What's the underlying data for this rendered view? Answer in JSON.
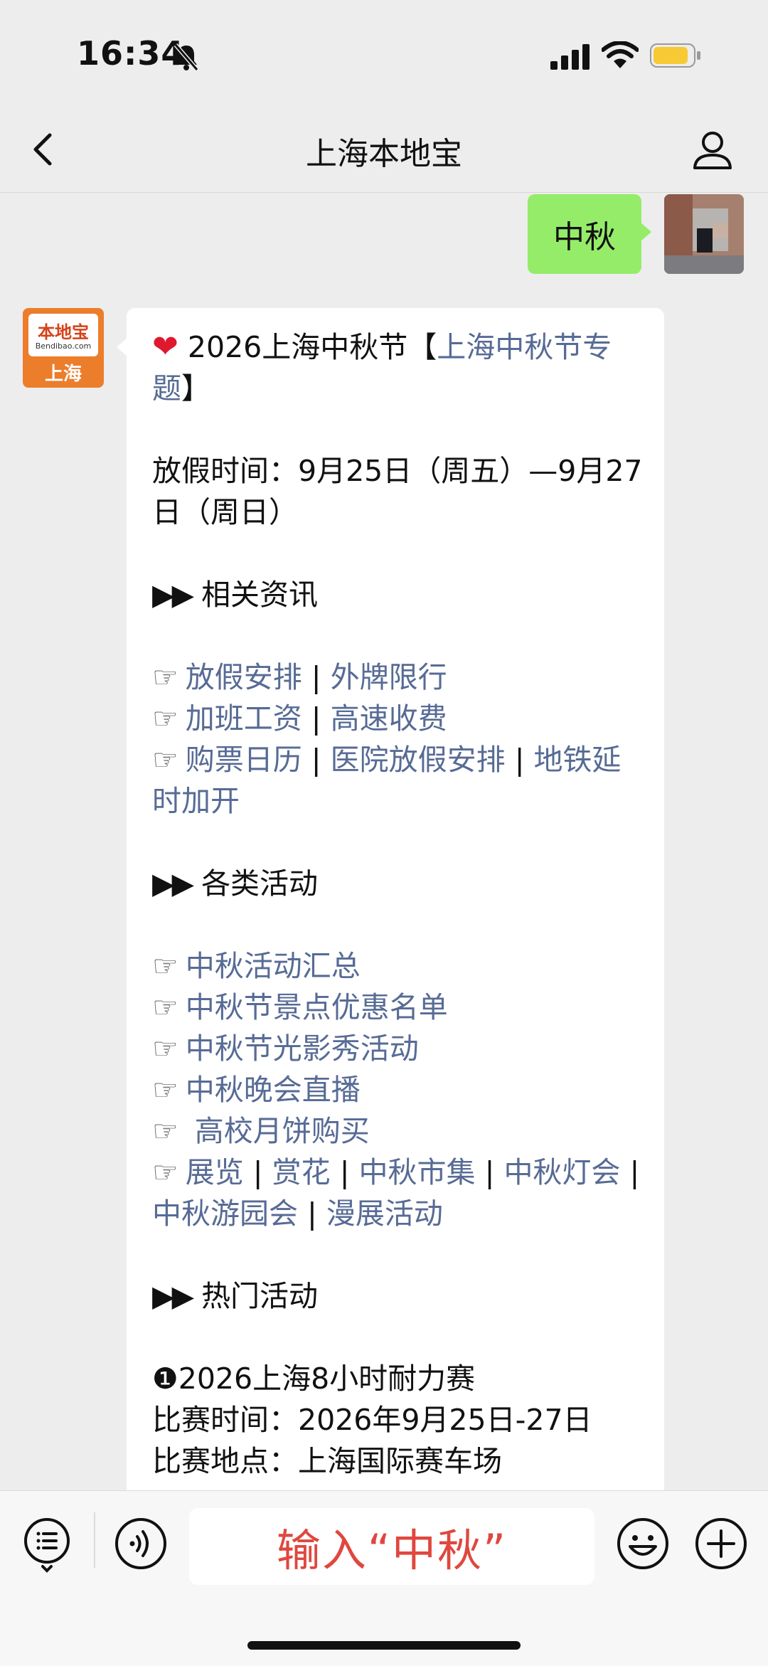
{
  "status": {
    "time": "16:34"
  },
  "nav": {
    "title": "上海本地宝"
  },
  "outgoing": {
    "text": "中秋"
  },
  "bot": {
    "brand": "本地宝",
    "site": "Bendibao.com",
    "city": "上海"
  },
  "message": {
    "header": {
      "prefix": "2026上海中秋节【",
      "link": "上海中秋节专题",
      "suffix": "】"
    },
    "holiday": "放假时间：9月25日（周五）—9月27日（周日）",
    "section1": "相关资讯",
    "news_rows": [
      [
        "放假安排",
        "外牌限行"
      ],
      [
        "加班工资",
        "高速收费"
      ],
      [
        "购票日历",
        "医院放假安排",
        "地铁延时加开"
      ]
    ],
    "section2": "各类活动",
    "activities": [
      "中秋活动汇总",
      "中秋节景点优惠名单",
      "中秋节光影秀活动",
      "中秋晚会直播",
      " 高校月饼购买"
    ],
    "activity_links": [
      "展览",
      "赏花",
      "中秋市集",
      "中秋灯会",
      "中秋游园会",
      "漫展活动"
    ],
    "section3": "热门活动",
    "hot_title": "❶2026上海8小时耐力赛",
    "hot_time": "比赛时间：2026年9月25日-27日",
    "hot_venue": "比赛地点：上海国际赛车场"
  },
  "toolbar": {
    "input_text": "输入“中秋”"
  },
  "colors": {
    "link": "#576b95",
    "outgoing_bubble": "#95ec69",
    "accent_text": "#e0473e"
  }
}
